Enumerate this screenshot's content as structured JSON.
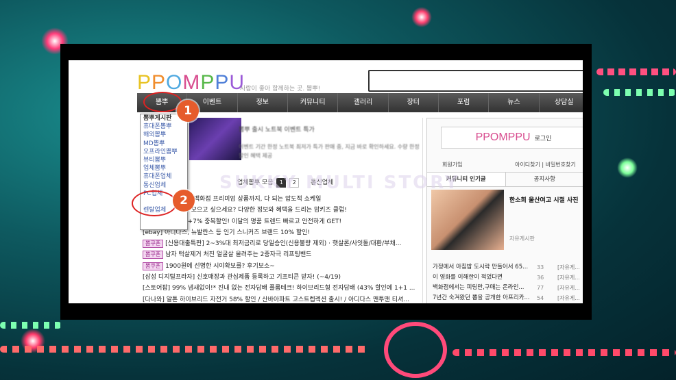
{
  "logo": {
    "text": "PPOMPPU",
    "tagline": "사람이 좋아 함께하는 곳. 뽐뿌!"
  },
  "nav": {
    "items": [
      "뽐뿌",
      "이벤트",
      "정보",
      "커뮤니티",
      "갤러리",
      "장터",
      "포럼",
      "뉴스",
      "상담실"
    ]
  },
  "dropdown": {
    "items": [
      "뽐뿌게시판",
      "휴대폰뽐뿌",
      "해외뽐뿌",
      "MD뽐뿌",
      "오프라인뽐뿌",
      "뷰티뽐뿌",
      "업체뽐뿌",
      "휴대폰업체",
      "통신업체",
      "PC업체",
      "렌탈업체"
    ]
  },
  "badges": {
    "one": "1",
    "two": "2"
  },
  "banner": {
    "title": "뽐뿌 출시 노트북 이벤트 특가",
    "desc": "이벤트 기간 한정 노트북 최저가 특가 판매 중, 지금 바로 확인하세요. 수량 한정 할인 혜택 제공"
  },
  "pager": {
    "label": "업체뽐뿌 모음",
    "pages": [
      "1",
      "2"
    ],
    "sublabel": "통신업체"
  },
  "list": [
    {
      "tag": "",
      "text": "뽐뿌 인기 방송부터 백화점 프리미엄 상품까지, 다 되는 압도적 쇼케일"
    },
    {
      "tag": "",
      "text": "[뽐뿌클럽] 포인트 모으고 싶으세요? 다양한 정보와 혜택을 드리는 맘키즈 클럽!"
    },
    {
      "tag": "",
      "text": "[롯데면세점] 7%+7% 중복할인! 이달의 명품 트렌드 빠르고 안전하게 GET!"
    },
    {
      "tag": "",
      "text": "[ebay] 아디다스, 뉴발란스 등 인기 스니커즈 브랜드 10% 할인!"
    },
    {
      "tag": "뽐쿠폰",
      "text": "[신용대출특판] 2~3%대 최저금리로 당일승인(신용불량 제외) · 햇살론/사잇돌/대환/부채..."
    },
    {
      "tag": "뽐쿠폰",
      "text": "남자 턱살제거 처진 얼굴살 올려주는 2중자극 리프팅밴드"
    },
    {
      "tag": "뽐쿠폰",
      "text": "1900원에 선명한 시야확보를? 후기보소~"
    },
    {
      "tag": "",
      "text": "[삼성 디지털프라자] 신호매장과 관심제품 등록하고 기프티콘 받자! (~4/19)"
    },
    {
      "tag": "",
      "text": "[스토어팜] 99% 냄새없이!* 진내 없는 전자담배 플룸테크! 하이브리드형 전자담배 (43% 할인에 1+1 ..."
    },
    {
      "tag": "",
      "text": "[다나와] 알톤 하이브리드 자전거 58% 할인 / 산바아파트 고스트렙렉션 출시! / 아디다스 맨투맨 티셔..."
    }
  ],
  "right": {
    "logo": "PPOMPPU",
    "login": "로그인",
    "join": "회원가입",
    "find": "아이디찾기 | 비밀번호찾기",
    "tabs": [
      "커뮤니티 인기글",
      "공지사항"
    ],
    "headline": "한소희 울산여고 시절 사진",
    "category": "자유게시판",
    "items": [
      {
        "t": "가정에서 아침밥 도시락 만들어서 65...",
        "c": "33",
        "g": "[자유게..."
      },
      {
        "t": "이 영화를 이해한이 적었다면",
        "c": "36",
        "g": "[자유게..."
      },
      {
        "t": "백화점에서는 피팅만,구매는 온라인...",
        "c": "77",
        "g": "[자유게..."
      },
      {
        "t": "7년간 숙겨왔던 뽐을 공개한 아프리카...",
        "c": "54",
        "g": "[자유게..."
      }
    ]
  },
  "watermark": "SUKKY MULTI STORY",
  "colors": {
    "accent": "#e65c2c",
    "highlight": "#d22222",
    "nav": "#3a3a3a"
  }
}
